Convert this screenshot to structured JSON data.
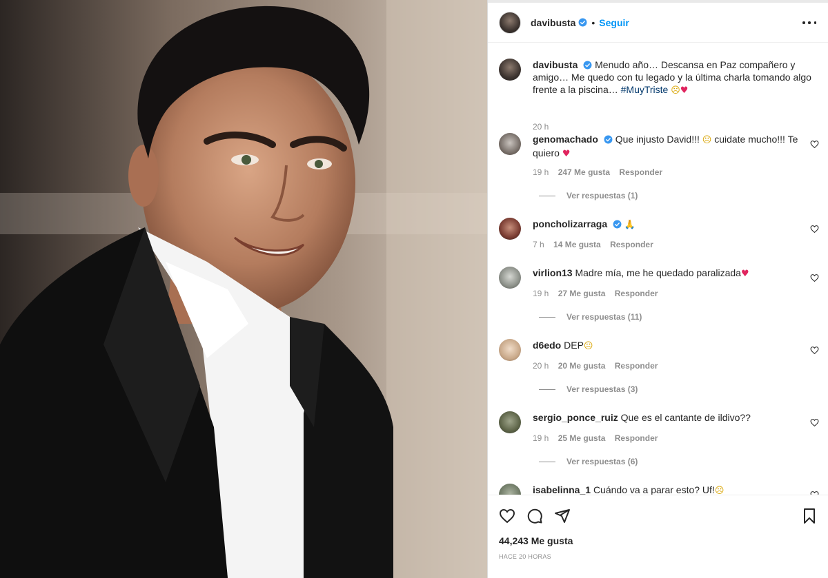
{
  "post": {
    "username": "davibusta",
    "follow_label": "Seguir",
    "separator": "•",
    "likes_count": "44,243 Me gusta",
    "posted_ago": "HACE 20 HORAS"
  },
  "caption": {
    "username": "davibusta",
    "text": "Menudo año… Descansa en Paz compañero y amigo… Me quedo con tu legado y la última charla tomando algo frente a la piscina…",
    "hashtag": "#MuyTriste",
    "emoji_1": "☹",
    "emoji_2": "♥",
    "time": "20 h"
  },
  "comments": [
    {
      "username": "genomachado",
      "text": "Que injusto David!!!",
      "emoji_a": "☹",
      "text2": "cuidate mucho!!! Te quiero",
      "emoji_b": "♥",
      "time": "19 h",
      "likes": "247 Me gusta",
      "reply": "Responder",
      "view_replies": "Ver respuestas (1)"
    },
    {
      "username": "poncholizarraga",
      "text": "",
      "emoji_a": "🙏",
      "time": "7 h",
      "likes": "14 Me gusta",
      "reply": "Responder"
    },
    {
      "username": "virlion13",
      "text": "Madre mía, me he quedado paralizada",
      "emoji_a": "♥",
      "time": "19 h",
      "likes": "27 Me gusta",
      "reply": "Responder",
      "view_replies": "Ver respuestas (11)"
    },
    {
      "username": "d6edo",
      "text": "DEP",
      "emoji_a": "☹",
      "time": "20 h",
      "likes": "20 Me gusta",
      "reply": "Responder",
      "view_replies": "Ver respuestas (3)"
    },
    {
      "username": "sergio_ponce_ruiz",
      "text": "Que es el cantante de ildivo??",
      "time": "19 h",
      "likes": "25 Me gusta",
      "reply": "Responder",
      "view_replies": "Ver respuestas (6)"
    },
    {
      "username": "isabelinna_1",
      "text": "Cuándo va a parar esto? Uf!",
      "emoji_a": "☹"
    }
  ],
  "icons": {
    "more": "more-options-icon",
    "like": "heart-icon",
    "comment": "comment-icon",
    "share": "share-icon",
    "save": "bookmark-icon",
    "verified": "verified-badge-icon"
  },
  "colors": {
    "accent": "#0095f6",
    "verified": "#3897f0",
    "muted": "#8e8e8e",
    "text": "#262626"
  }
}
